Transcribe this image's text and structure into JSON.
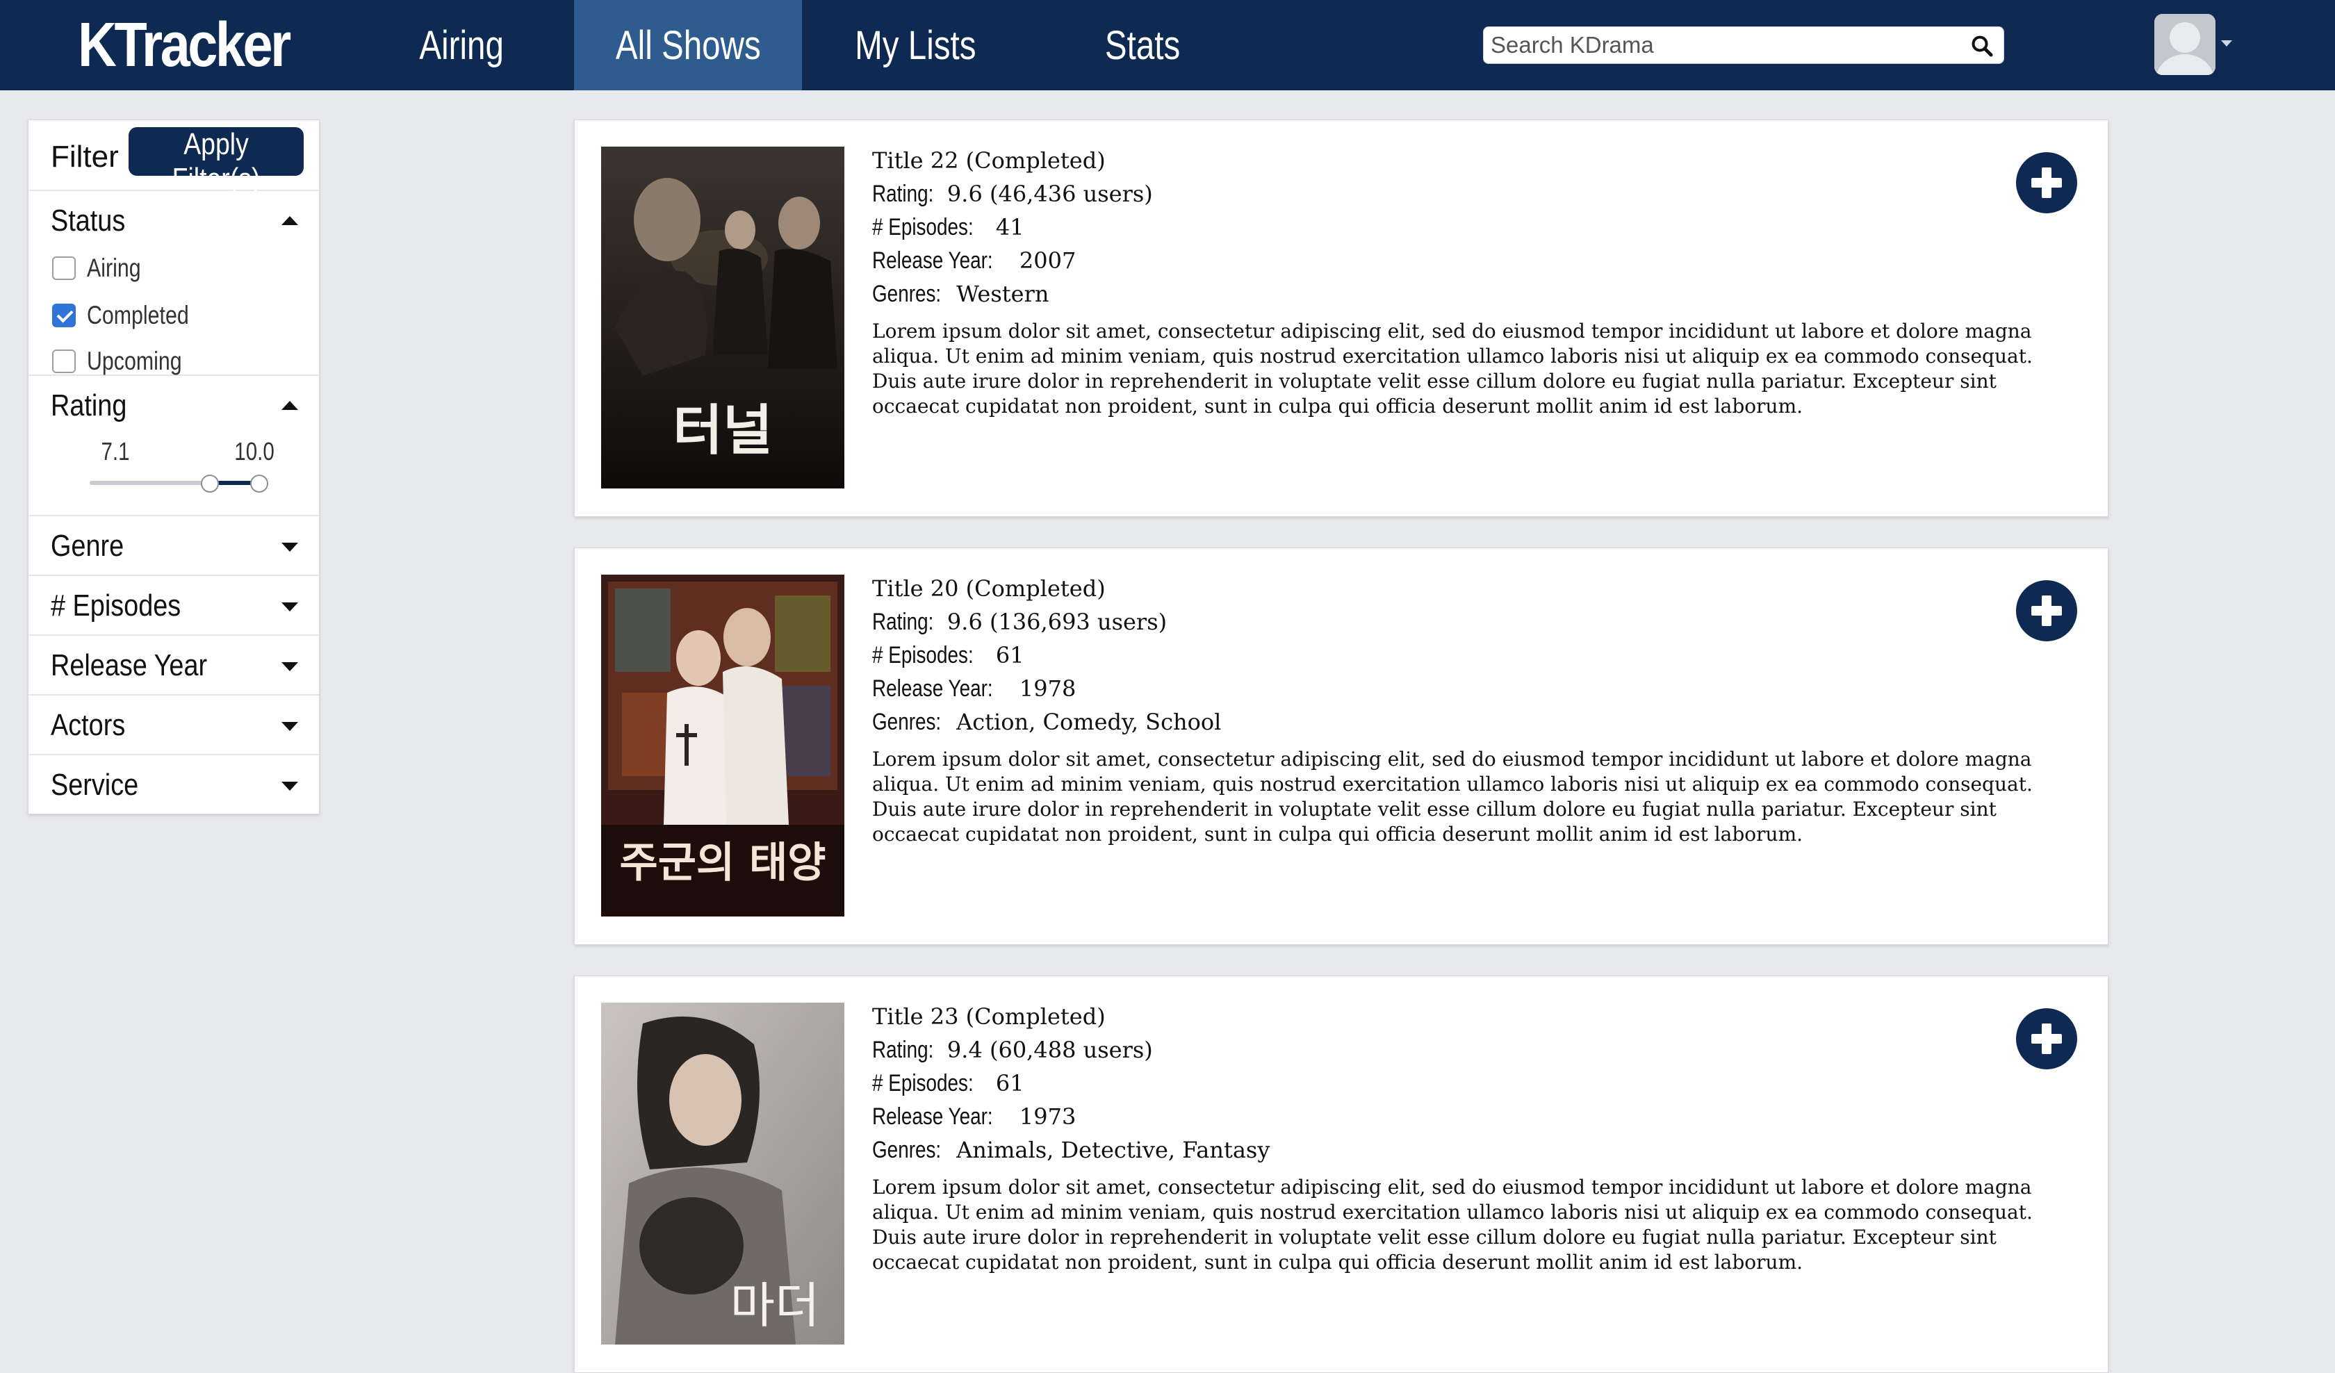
{
  "app": {
    "brand": "KTracker"
  },
  "nav": {
    "items": [
      "Airing",
      "All Shows",
      "My Lists",
      "Stats"
    ],
    "active": "All Shows"
  },
  "search": {
    "placeholder": "Search KDrama",
    "value": ""
  },
  "filters": {
    "title": "Filter",
    "apply_label": "Apply Filter(s)",
    "status": {
      "title": "Status",
      "options": [
        {
          "label": "Airing",
          "checked": false
        },
        {
          "label": "Completed",
          "checked": true
        },
        {
          "label": "Upcoming",
          "checked": false
        }
      ]
    },
    "rating": {
      "title": "Rating",
      "min_label": "7.1",
      "max_label": "10.0",
      "range_min": 0,
      "range_max": 10,
      "low": 7.1,
      "high": 10.0
    },
    "collapsed": [
      "Genre",
      "# Episodes",
      "Release Year",
      "Actors",
      "Service"
    ]
  },
  "labels": {
    "rating": "Rating:",
    "episodes": "# Episodes:",
    "release_year": "Release Year:",
    "genres": "Genres:"
  },
  "shows": [
    {
      "title": "Title 22 (Completed)",
      "rating": "9.6 (46,436 users)",
      "episodes": "41",
      "release_year": "2007",
      "genres": "Western",
      "description": "Lorem ipsum dolor sit amet, consectetur adipiscing elit, sed do eiusmod tempor incididunt ut labore et dolore magna aliqua. Ut enim ad minim veniam, quis nostrud exercitation ullamco laboris nisi ut aliquip ex ea commodo consequat. Duis aute irure dolor in reprehenderit in voluptate velit esse cillum dolore eu fugiat nulla pariatur. Excepteur sint occaecat cupidatat non proident, sunt in culpa qui officia deserunt mollit anim id est laborum.",
      "poster_text": "터널"
    },
    {
      "title": "Title 20 (Completed)",
      "rating": "9.6 (136,693 users)",
      "episodes": "61",
      "release_year": "1978",
      "genres": "Action, Comedy, School",
      "description": "Lorem ipsum dolor sit amet, consectetur adipiscing elit, sed do eiusmod tempor incididunt ut labore et dolore magna aliqua. Ut enim ad minim veniam, quis nostrud exercitation ullamco laboris nisi ut aliquip ex ea commodo consequat. Duis aute irure dolor in reprehenderit in voluptate velit esse cillum dolore eu fugiat nulla pariatur. Excepteur sint occaecat cupidatat non proident, sunt in culpa qui officia deserunt mollit anim id est laborum.",
      "poster_text": "주군의 태양"
    },
    {
      "title": "Title 23 (Completed)",
      "rating": "9.4 (60,488 users)",
      "episodes": "61",
      "release_year": "1973",
      "genres": "Animals, Detective, Fantasy",
      "description": "Lorem ipsum dolor sit amet, consectetur adipiscing elit, sed do eiusmod tempor incididunt ut labore et dolore magna aliqua. Ut enim ad minim veniam, quis nostrud exercitation ullamco laboris nisi ut aliquip ex ea commodo consequat. Duis aute irure dolor in reprehenderit in voluptate velit esse cillum dolore eu fugiat nulla pariatur. Excepteur sint occaecat cupidatat non proident, sunt in culpa qui officia deserunt mollit anim id est laborum.",
      "poster_text": "마더"
    }
  ],
  "colors": {
    "navy": "#0f2a52",
    "nav_active": "#2e5c8e",
    "checkbox": "#2f74d6",
    "page_bg": "#e8e9ec"
  }
}
